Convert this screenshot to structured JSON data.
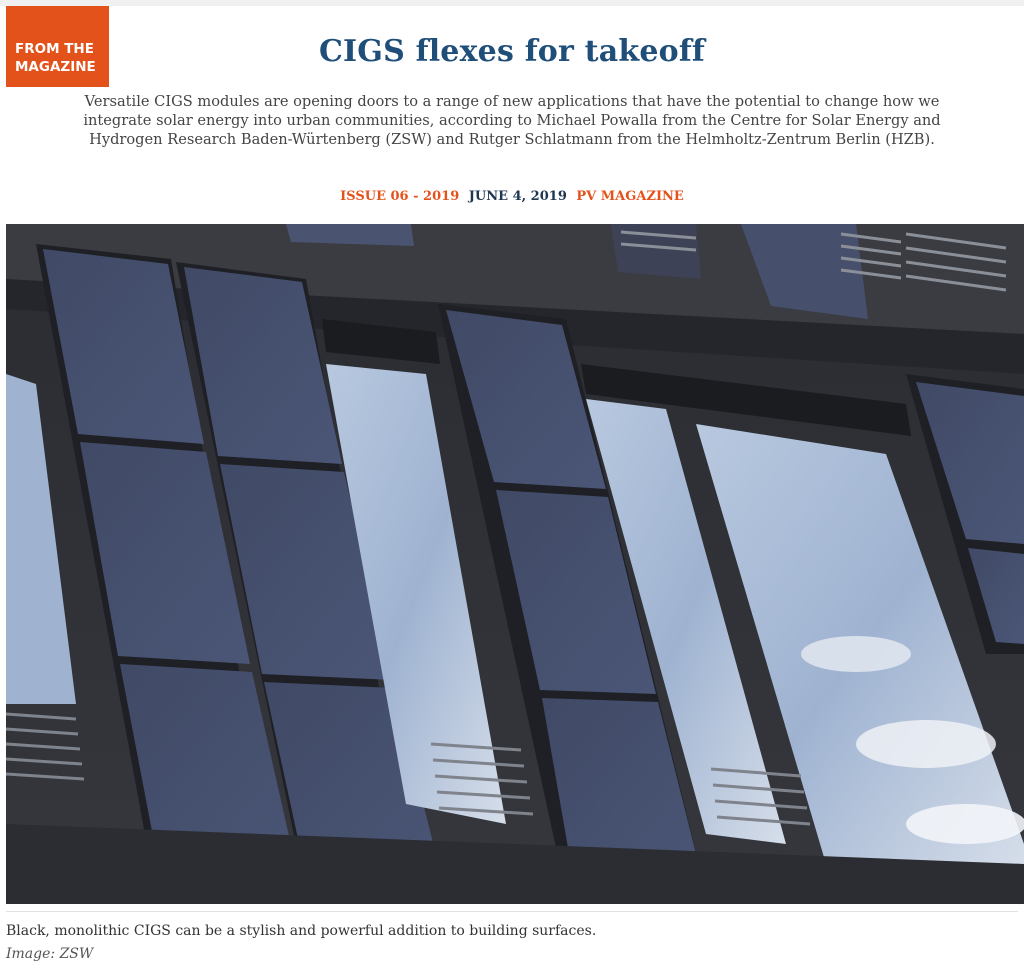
{
  "badge": {
    "line1": "FROM THE",
    "line2": "MAGAZINE"
  },
  "article": {
    "title": "CIGS flexes for takeoff",
    "lead": "Versatile CIGS modules are opening doors to a range of new applications that have the potential to change how we integrate solar energy into urban communities, according to Michael Powalla from the Centre for Solar Energy and Hydrogen Research Baden-Würtenberg (ZSW) and Rutger Schlatmann from the Helmholtz-Zentrum Berlin (HZB).",
    "issue": "ISSUE 06 - 2019",
    "date": "JUNE 4, 2019",
    "publication": "PV MAGAZINE"
  },
  "image": {
    "caption": "Black, monolithic CIGS can be a stylish and powerful addition to building surfaces.",
    "credit": "Image: ZSW"
  },
  "colors": {
    "accent": "#e4521b",
    "title": "#1f4e79"
  }
}
